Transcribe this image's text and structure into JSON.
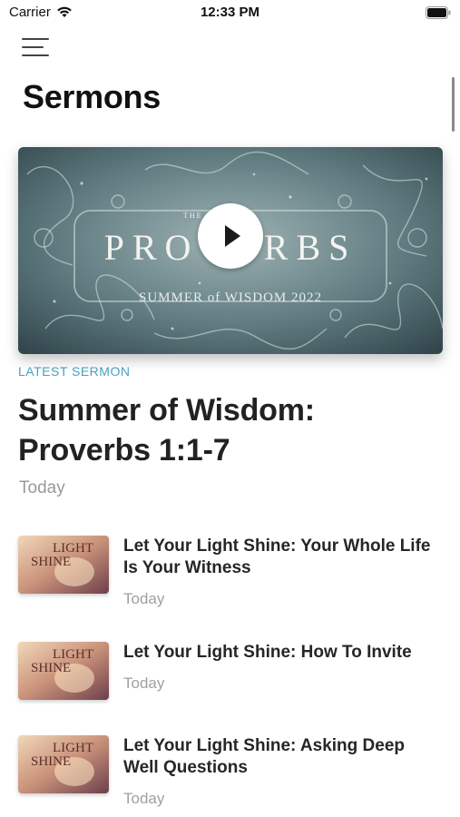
{
  "status_bar": {
    "carrier": "Carrier",
    "time": "12:33 PM"
  },
  "header": {
    "title": "Sermons",
    "menu_icon": "hamburger-menu-icon"
  },
  "featured": {
    "art_title": "PROVERBS",
    "art_overline": "THE BOOK OF",
    "art_subtitle": "SUMMER of WISDOM 2022",
    "label": "LATEST SERMON",
    "title": "Summer of Wisdom: Proverbs 1:1-7",
    "date": "Today",
    "play_icon": "play-icon"
  },
  "sermons": [
    {
      "title": "Let Your Light Shine: Your Whole Life Is Your Witness",
      "date": "Today",
      "thumb_text": [
        "LIGHT",
        "SHINE"
      ]
    },
    {
      "title": "Let Your Light Shine: How To Invite",
      "date": "Today",
      "thumb_text": [
        "LIGHT",
        "SHINE"
      ]
    },
    {
      "title": "Let Your Light Shine: Asking Deep Well Questions",
      "date": "Today",
      "thumb_text": [
        "LIGHT",
        "SHINE"
      ]
    }
  ],
  "colors": {
    "accent": "#4aa0c0",
    "muted": "#9a9a9a"
  }
}
